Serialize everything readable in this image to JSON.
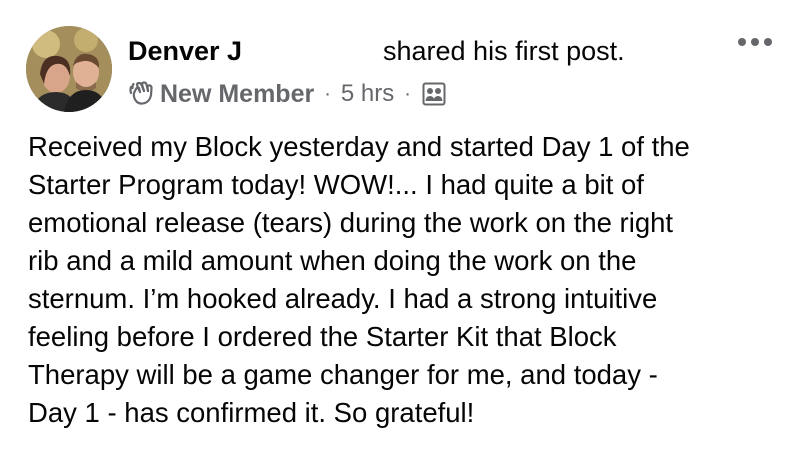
{
  "post": {
    "author_name": "Denver J",
    "action_text": "shared his first post.",
    "badge_label": "New Member",
    "timestamp": "5 hrs",
    "separator": "·",
    "body_lines": [
      "Received my Block yesterday and started Day 1 of the",
      "Starter Program today! WOW!... I had quite a bit of",
      "emotional release (tears) during the work on the right",
      "rib and a mild amount when doing the work on the",
      "sternum. I’m hooked already. I had a strong intuitive",
      "feeling before I ordered the Starter Kit that Block",
      "Therapy will be a game changer for me, and today -",
      "Day 1 - has confirmed it. So grateful!"
    ]
  },
  "icons": {
    "badge": "waving-hand-icon",
    "audience": "group-members-icon",
    "more": "more-options-icon"
  },
  "colors": {
    "text_primary": "#050505",
    "text_secondary": "#65676b",
    "background": "#ffffff"
  }
}
